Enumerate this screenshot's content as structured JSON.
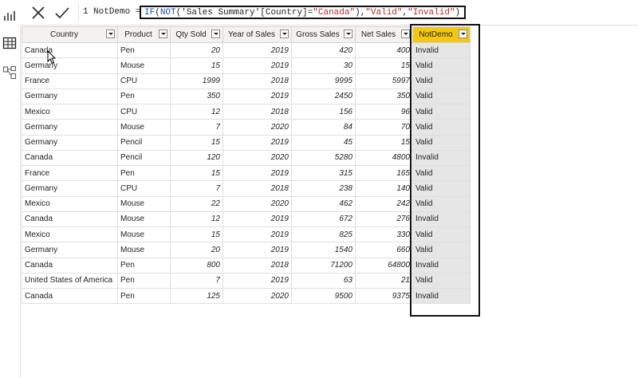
{
  "formula": {
    "line_number": "1",
    "measure_name": "NotDemo =",
    "expr": {
      "if_kw": "IF",
      "open1": "(",
      "not_kw": "NOT",
      "ref_open": "(",
      "table_ref": "'Sales Summary'[Country]",
      "eq": "=",
      "canada": "\"Canada\"",
      "close_not": "),",
      "valid": "\"Valid\"",
      "comma": ",",
      "invalid": "\"Invalid\"",
      "close_if": ")"
    }
  },
  "table": {
    "headers": [
      "Country",
      "Product",
      "Qty Sold",
      "Year of Sales",
      "Gross Sales",
      "Net Sales",
      "NotDemo"
    ],
    "rows": [
      [
        "Canada",
        "Pen",
        "20",
        "2019",
        "420",
        "400",
        "Invalid"
      ],
      [
        "Germany",
        "Mouse",
        "15",
        "2019",
        "30",
        "15",
        "Valid"
      ],
      [
        "France",
        "CPU",
        "1999",
        "2018",
        "9995",
        "5997",
        "Valid"
      ],
      [
        "Germany",
        "Pen",
        "350",
        "2019",
        "2450",
        "350",
        "Valid"
      ],
      [
        "Mexico",
        "CPU",
        "12",
        "2018",
        "156",
        "96",
        "Valid"
      ],
      [
        "Germany",
        "Mouse",
        "7",
        "2020",
        "84",
        "70",
        "Valid"
      ],
      [
        "Germany",
        "Pencil",
        "15",
        "2019",
        "45",
        "15",
        "Valid"
      ],
      [
        "Canada",
        "Pencil",
        "120",
        "2020",
        "5280",
        "4800",
        "Invalid"
      ],
      [
        "France",
        "Pen",
        "15",
        "2019",
        "315",
        "165",
        "Valid"
      ],
      [
        "Germany",
        "CPU",
        "7",
        "2018",
        "238",
        "140",
        "Valid"
      ],
      [
        "Mexico",
        "Mouse",
        "22",
        "2020",
        "462",
        "242",
        "Valid"
      ],
      [
        "Canada",
        "Mouse",
        "12",
        "2019",
        "672",
        "276",
        "Invalid"
      ],
      [
        "Mexico",
        "Mouse",
        "15",
        "2019",
        "825",
        "330",
        "Valid"
      ],
      [
        "Germany",
        "Mouse",
        "20",
        "2019",
        "1540",
        "660",
        "Valid"
      ],
      [
        "Canada",
        "Pen",
        "800",
        "2018",
        "71200",
        "64800",
        "Invalid"
      ],
      [
        "United States of America",
        "Pen",
        "7",
        "2019",
        "63",
        "21",
        "Valid"
      ],
      [
        "Canada",
        "Pen",
        "125",
        "2020",
        "9500",
        "9375",
        "Invalid"
      ]
    ]
  },
  "icons": {
    "rail": [
      "report-view-icon",
      "data-view-icon",
      "model-view-icon"
    ],
    "formula": [
      "cancel-icon",
      "commit-check-icon"
    ]
  },
  "colors": {
    "selected_header": "#f2c811",
    "selected_column": "#e6e6e6",
    "keyword": "#1f4eb4",
    "string": "#b52d2d"
  }
}
